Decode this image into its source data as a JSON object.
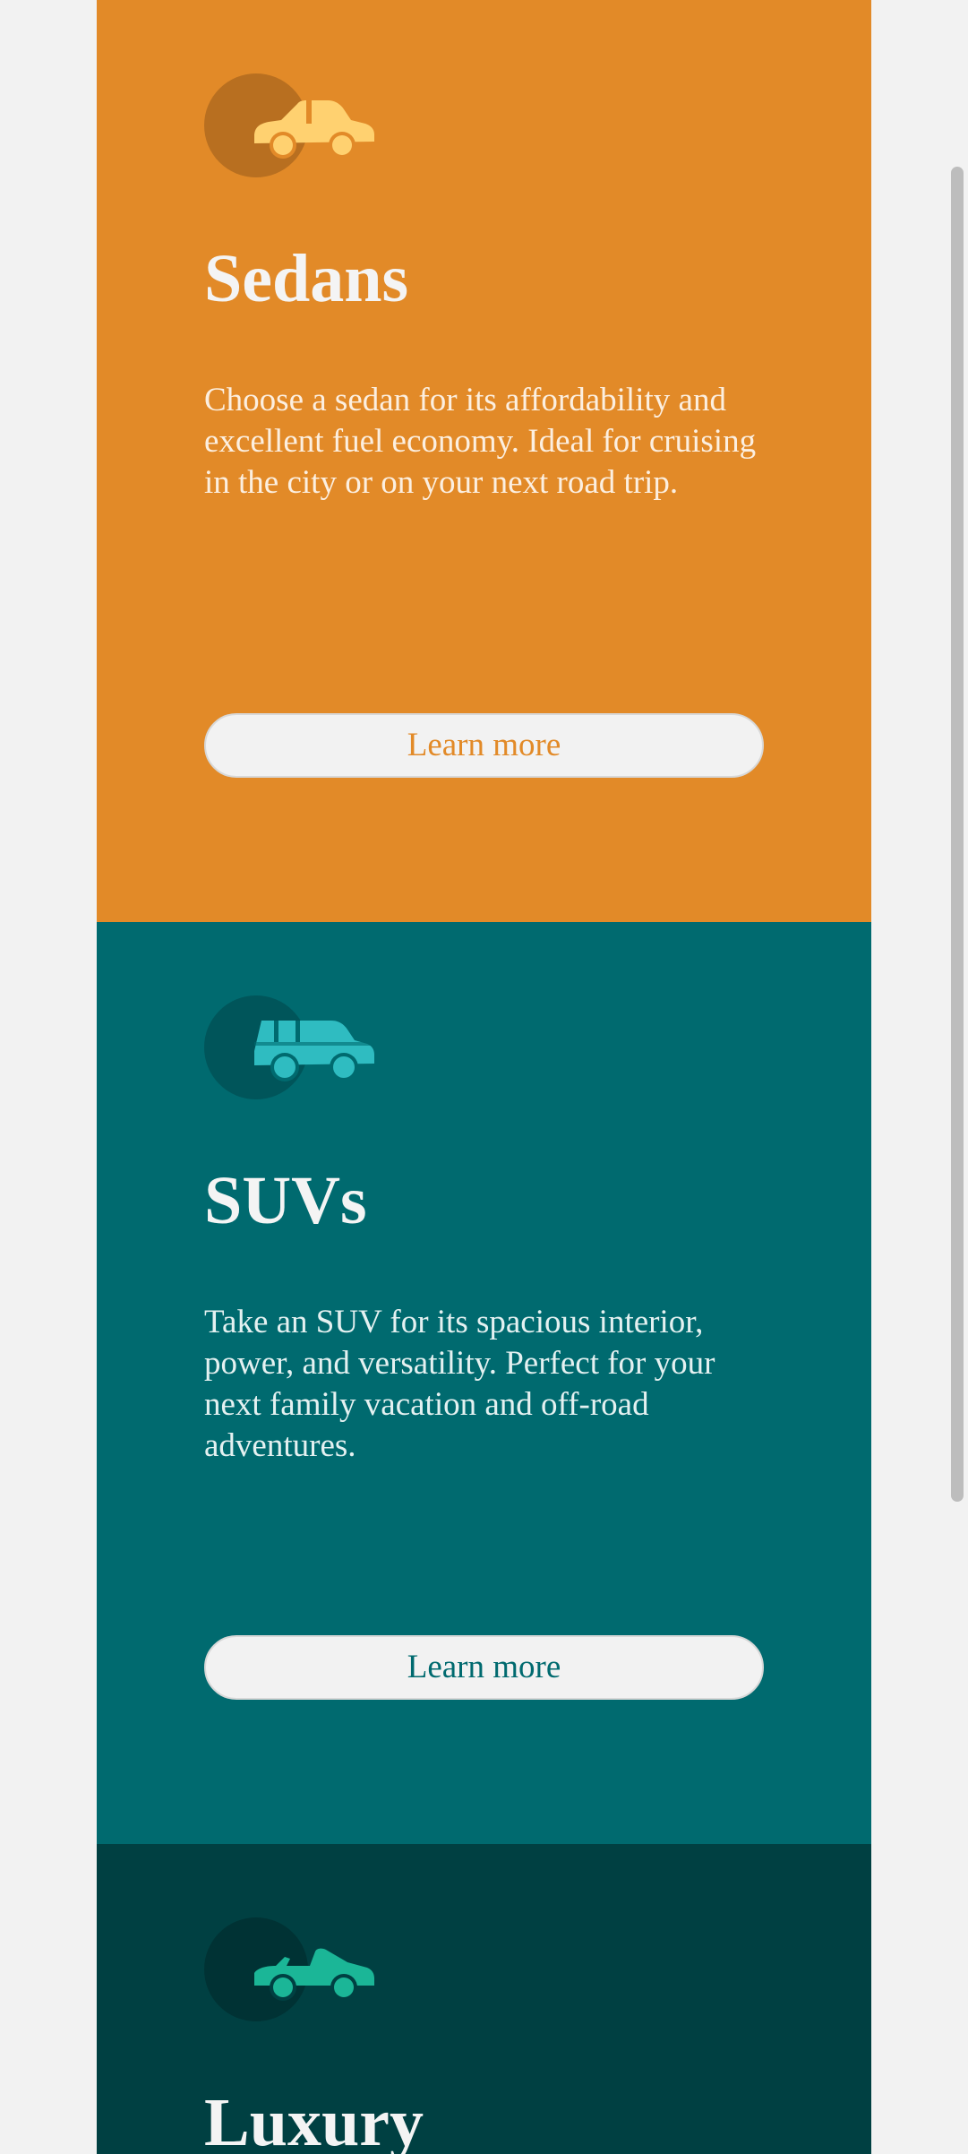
{
  "cards": [
    {
      "icon": "sedan-car-icon",
      "title": "Sedans",
      "description": "Choose a sedan for its affordability and excellent fuel economy. Ideal for cruising in the city or on your next road trip.",
      "button_label": "Learn more",
      "background_color": "#e28a28",
      "icon_color": "#ffd170"
    },
    {
      "icon": "suv-car-icon",
      "title": "SUVs",
      "description": "Take an SUV for its spacious interior, power, and versatility. Perfect for your next family vacation and off-road adventures.",
      "button_label": "Learn more",
      "background_color": "#006a6f",
      "icon_color": "#2fbcc1"
    },
    {
      "icon": "luxury-convertible-icon",
      "title": "Luxury",
      "background_color": "#004042",
      "icon_color": "#1bb697"
    }
  ]
}
